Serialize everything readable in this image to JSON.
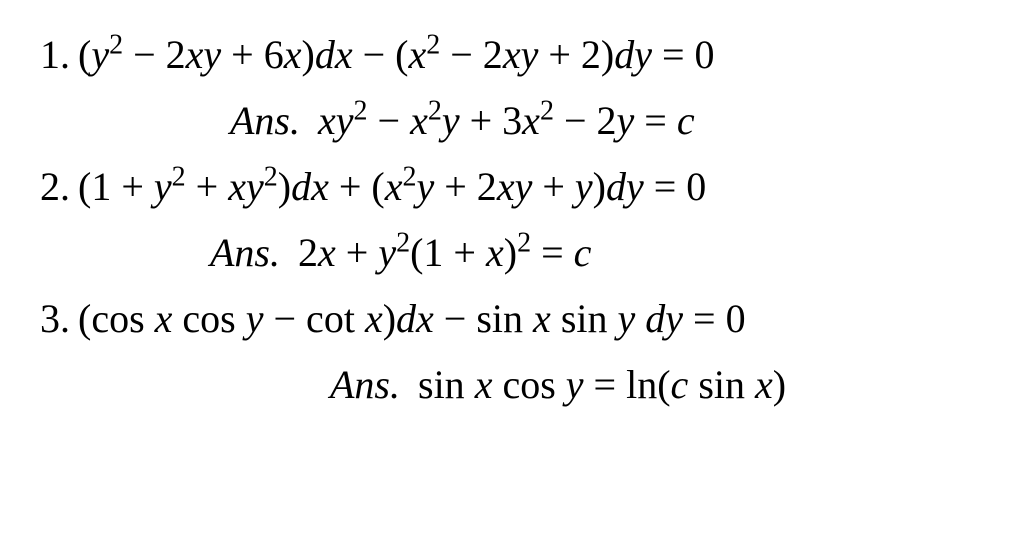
{
  "problems": [
    {
      "number": "1.",
      "equation": "(y² − 2xy + 6x) dx − (x² − 2xy + 2) dy = 0",
      "answer_label": "Ans.",
      "answer": "xy² − x²y + 3x² − 2y = c"
    },
    {
      "number": "2.",
      "equation": "(1 + y² + xy²) dx + (x²y + 2xy + y) dy = 0",
      "answer_label": "Ans.",
      "answer": "2x + y²(1 + x)² = c"
    },
    {
      "number": "3.",
      "equation": "(cos x cos y − cot x) dx − sin x sin y dy = 0",
      "answer_label": "Ans.",
      "answer": "sin x cos y = ln(c sin x)"
    }
  ]
}
